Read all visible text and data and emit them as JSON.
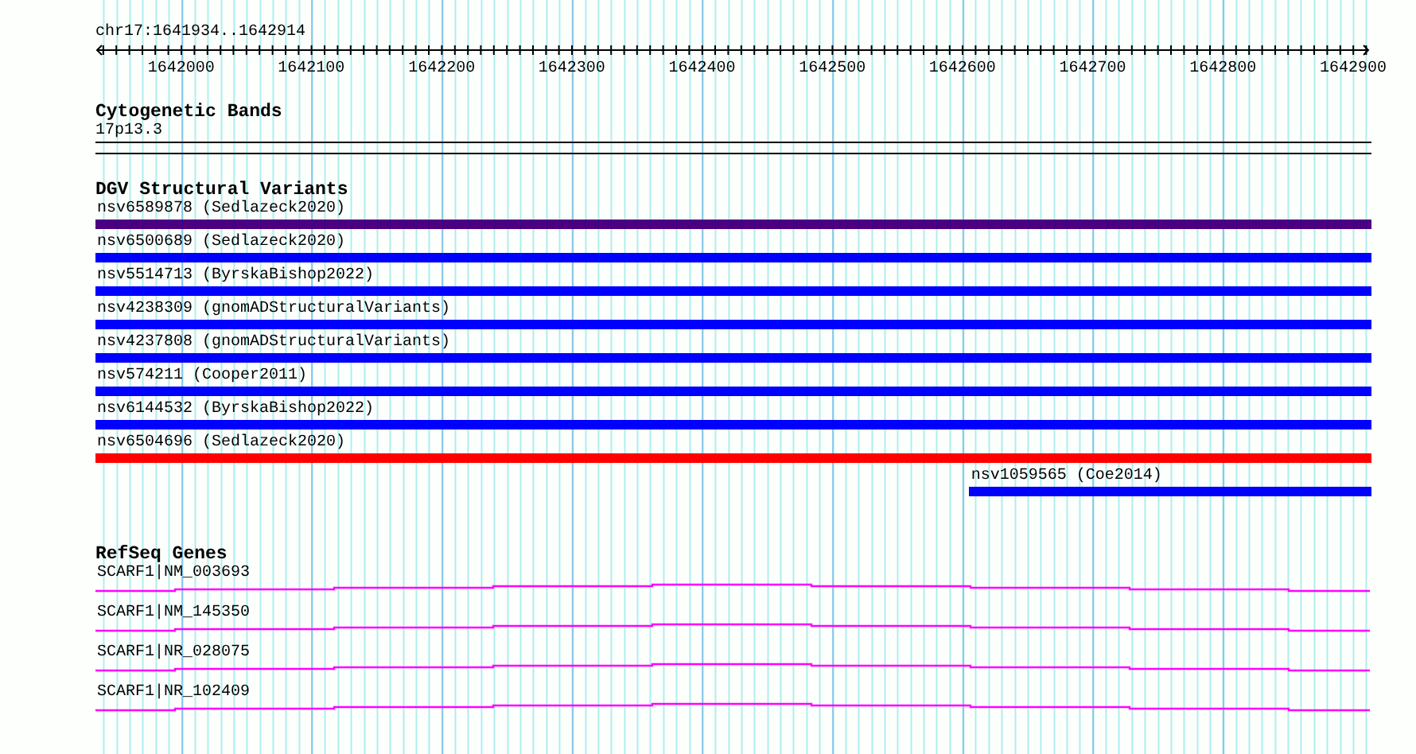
{
  "ruler": {
    "location": "chr17:1641934..1642914",
    "ticks": [
      "1642000",
      "1642100",
      "1642200",
      "1642300",
      "1642400",
      "1642500",
      "1642600",
      "1642700",
      "1642800",
      "1642900"
    ]
  },
  "cytogenetic_bands": {
    "title": "Cytogenetic Bands",
    "band": "17p13.3"
  },
  "dgv_structural_variants": {
    "title": "DGV Structural Variants",
    "variants": [
      {
        "label": "nsv6589878 (Sedlazeck2020)",
        "color": "#4b0082",
        "level": 1
      },
      {
        "label": "nsv6500689 (Sedlazeck2020)",
        "color": "#0000ff",
        "level": 1
      },
      {
        "label": "nsv5514713 (ByrskaBishop2022)",
        "color": "#0000ff",
        "level": 1
      },
      {
        "label": "nsv4238309 (gnomADStructuralVariants)",
        "color": "#0000ff",
        "level": 1
      },
      {
        "label": "nsv4237808 (gnomADStructuralVariants)",
        "color": "#0000ff",
        "level": 1
      },
      {
        "label": "nsv574211 (Cooper2011)",
        "color": "#0000ff",
        "level": 1
      },
      {
        "label": "nsv6144532 (ByrskaBishop2022)",
        "color": "#0000ff",
        "level": 1
      },
      {
        "label": "nsv6504696 (Sedlazeck2020)",
        "color": "#ff0000",
        "level": 1
      },
      {
        "label": "nsv1059565 (Coe2014)",
        "color": "#0000ff",
        "level": 0.315
      }
    ]
  },
  "refseq_genes": {
    "title": "RefSeq Genes",
    "transcripts": [
      {
        "label": "SCARF1|NM_003693"
      },
      {
        "label": "SCARF1|NM_145350"
      },
      {
        "label": "SCARF1|NR_028075"
      },
      {
        "label": "SCARF1|NR_102409"
      }
    ]
  }
}
